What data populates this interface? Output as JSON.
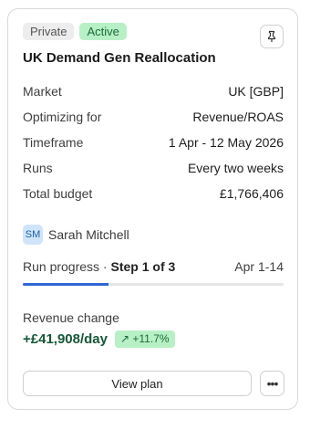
{
  "badges": {
    "visibility": "Private",
    "status": "Active"
  },
  "title": "UK Demand Gen Reallocation",
  "details": [
    {
      "label": "Market",
      "value": "UK [GBP]"
    },
    {
      "label": "Optimizing for",
      "value": "Revenue/ROAS"
    },
    {
      "label": "Timeframe",
      "value": "1 Apr - 12 May 2026"
    },
    {
      "label": "Runs",
      "value": "Every two weeks"
    },
    {
      "label": "Total budget",
      "value": "£1,766,406"
    }
  ],
  "owner": {
    "initials": "SM",
    "name": "Sarah Mitchell"
  },
  "progress": {
    "label": "Run progress · ",
    "step": "Step 1 of 3",
    "dates": "Apr 1-14",
    "fraction": 0.33
  },
  "revenue": {
    "label": "Revenue change",
    "value": "+£41,908/day",
    "delta": "↗ +11.7%"
  },
  "actions": {
    "view_plan": "View plan",
    "more": "•••"
  },
  "colors": {
    "accent": "#2f66d4",
    "positive": "#15573a",
    "active_bg": "#b8f0c6"
  }
}
